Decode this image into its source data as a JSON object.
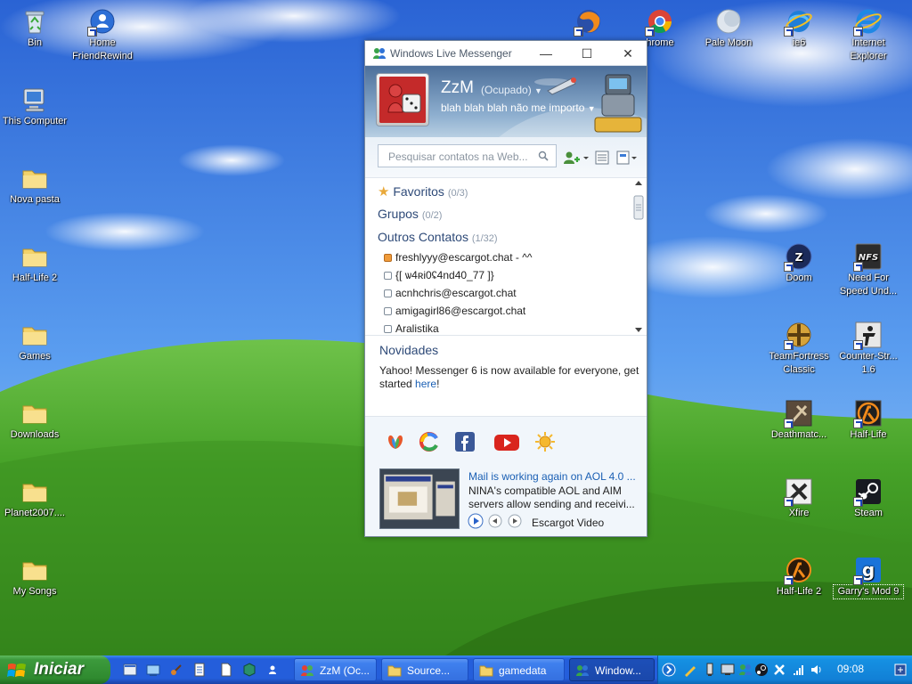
{
  "desktop": {
    "icons_left": [
      {
        "label": "Bin",
        "icon": "recycle-bin-icon"
      },
      {
        "label": "This Computer",
        "icon": "computer-icon"
      },
      {
        "label": "Nova pasta",
        "icon": "folder-icon"
      },
      {
        "label": "Half-Life 2",
        "icon": "folder-icon"
      },
      {
        "label": "Games",
        "icon": "folder-icon"
      },
      {
        "label": "Downloads",
        "icon": "folder-icon"
      },
      {
        "label": "Planet2007....",
        "icon": "folder-icon"
      },
      {
        "label": "My Songs",
        "icon": "folder-icon"
      }
    ],
    "icon_home": {
      "label": "Home FriendRewind",
      "icon": "user-icon"
    },
    "icons_top": [
      {
        "label": "",
        "icon": "firefox-icon"
      },
      {
        "label": "hrome",
        "icon": "chrome-icon"
      },
      {
        "label": "Pale Moon",
        "icon": "palemoon-icon"
      },
      {
        "label": "ie6",
        "icon": "ie6-icon"
      },
      {
        "label": "Internet Explorer",
        "icon": "internet-explorer-icon"
      }
    ],
    "icons_right": [
      {
        "label": "Doom",
        "icon": "doom-icon"
      },
      {
        "label": "Need For Speed Und...",
        "icon": "nfs-icon"
      },
      {
        "label": "TeamFortress Classic",
        "icon": "tfc-icon"
      },
      {
        "label": "Counter-Str... 1.6",
        "icon": "counter-strike-icon"
      },
      {
        "label": "Deathmatc...",
        "icon": "deathmatch-icon"
      },
      {
        "label": "Half-Life",
        "icon": "half-life-icon"
      },
      {
        "label": "Xfire",
        "icon": "xfire-icon"
      },
      {
        "label": "Steam",
        "icon": "steam-icon"
      },
      {
        "label": "Half-Life 2",
        "icon": "half-life-2-icon"
      },
      {
        "label": "Garry's Mod 9",
        "icon": "garrys-mod-icon"
      }
    ]
  },
  "messenger": {
    "title": "Windows Live Messenger",
    "nickname": "ZzM",
    "status": "(Ocupado)",
    "personal_message": "blah blah blah não me importo",
    "search_placeholder": "Pesquisar contatos na Web...",
    "groups": [
      {
        "name": "Favoritos",
        "count": "(0/3)"
      },
      {
        "name": "Grupos",
        "count": "(0/2)"
      },
      {
        "name": "Outros Contatos",
        "count": "(1/32)"
      }
    ],
    "contacts": [
      {
        "name": "freshlyyy@escargot.chat - ^^",
        "status": "busy"
      },
      {
        "name": "{[ ѡ4ʀi0ʢ4nd40_77 ]}",
        "status": "offline"
      },
      {
        "name": "acnhchris@escargot.chat",
        "status": "offline"
      },
      {
        "name": "amigagirl86@escargot.chat",
        "status": "offline"
      },
      {
        "name": "Aralistika",
        "status": "offline"
      }
    ],
    "news_heading": "Novidades",
    "news_text": "Yahoo! Messenger 6 is now available for everyone, get started ",
    "news_link": "here",
    "news_end": "!",
    "video_title": "Mail is working again on AOL 4.0 ...",
    "video_desc": "NINA's compatible AOL and AIM servers allow sending and receivi...",
    "video_source": "Escargot Video",
    "accent": "#2e4a78"
  },
  "taskbar": {
    "start_label": "Iniciar",
    "tasks": [
      {
        "label": "ZzM (Oc...",
        "icon": "messenger-icon"
      },
      {
        "label": "Source...",
        "icon": "folder-icon"
      },
      {
        "label": "gamedata",
        "icon": "folder-icon"
      },
      {
        "label": "Window...",
        "icon": "messenger-icon"
      }
    ],
    "clock": "09:08"
  }
}
